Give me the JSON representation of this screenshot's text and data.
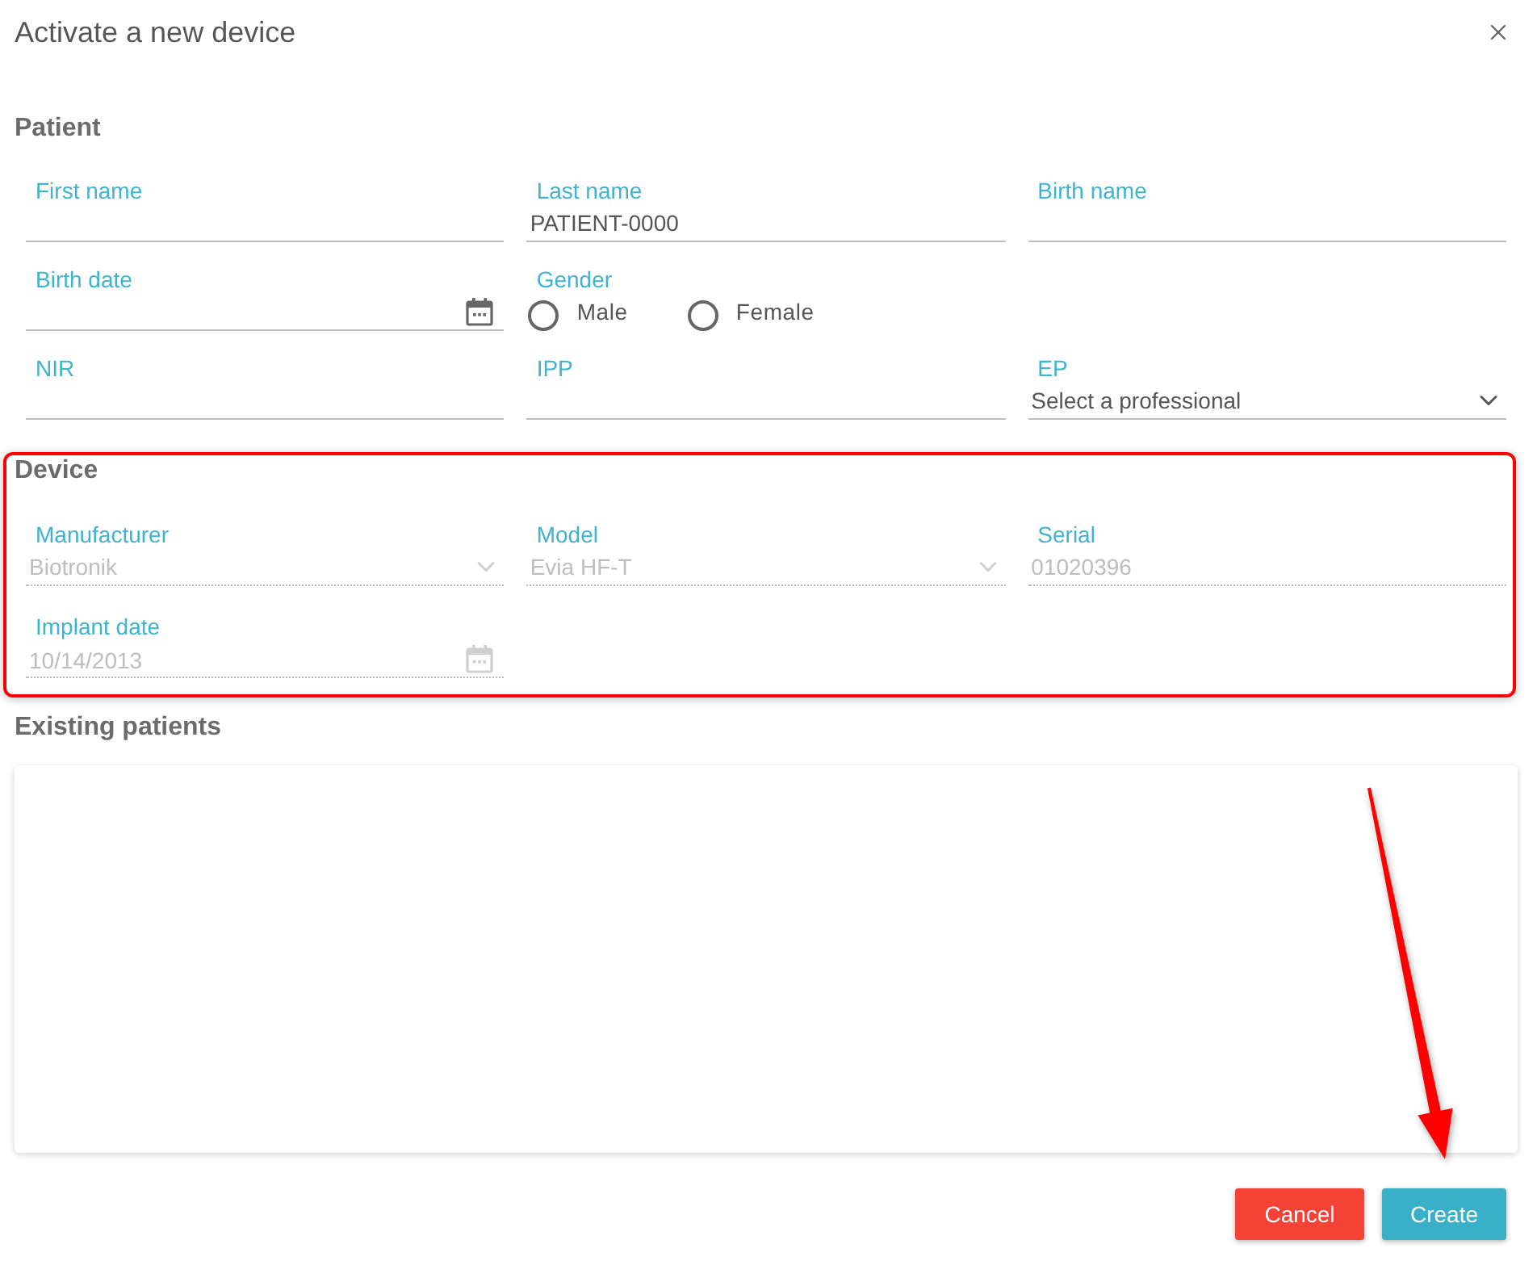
{
  "dialog": {
    "title": "Activate a new device"
  },
  "patient": {
    "heading": "Patient",
    "rows": [
      [
        {
          "kind": "text",
          "label": "First name"
        },
        {
          "kind": "text",
          "label": "Last name",
          "value": "PATIENT-0000"
        },
        {
          "kind": "text",
          "label": "Birth name"
        }
      ],
      [
        {
          "kind": "date",
          "label": "Birth date"
        },
        {
          "kind": "radio",
          "label": "Gender",
          "options": [
            {
              "label": "Male",
              "selected": false
            },
            {
              "label": "Female",
              "selected": false
            }
          ]
        }
      ],
      [
        {
          "kind": "text",
          "label": "NIR"
        },
        {
          "kind": "text",
          "label": "IPP"
        },
        {
          "kind": "select",
          "label": "EP",
          "placeholder": "Select a professional"
        }
      ]
    ]
  },
  "device": {
    "heading": "Device",
    "highlighted": true,
    "rows": [
      [
        {
          "kind": "select",
          "label": "Manufacturer",
          "value": "Biotronik",
          "disabled": true
        },
        {
          "kind": "select",
          "label": "Model",
          "value": "Evia HF-T",
          "disabled": true
        },
        {
          "kind": "text",
          "label": "Serial",
          "value": "01020396",
          "disabled": true
        }
      ],
      [
        {
          "kind": "date",
          "label": "Implant date",
          "value": "10/14/2013",
          "disabled": true
        }
      ]
    ]
  },
  "existing_patients": {
    "heading": "Existing patients"
  },
  "buttons": [
    {
      "kind": "cancel",
      "label": "Cancel"
    },
    {
      "kind": "primary",
      "label": "Create"
    }
  ]
}
